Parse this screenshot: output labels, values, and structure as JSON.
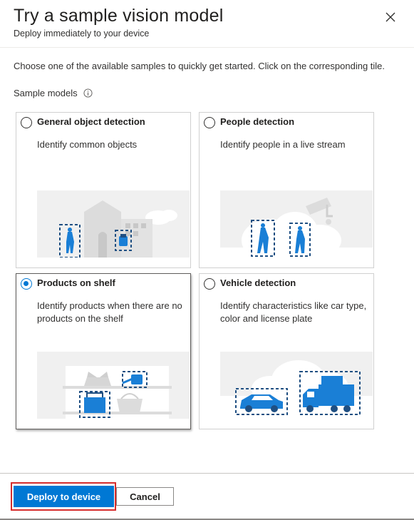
{
  "header": {
    "title": "Try a sample vision model",
    "subtitle": "Deploy immediately to your device",
    "close_icon": "close-icon"
  },
  "intro": "Choose one of the available samples to quickly get started. Click on the corresponding tile.",
  "section": {
    "label": "Sample models",
    "info_icon": "info-icon"
  },
  "tiles": [
    {
      "title": "General object detection",
      "description": "Identify common objects",
      "selected": false
    },
    {
      "title": "People detection",
      "description": "Identify people in a live stream",
      "selected": false
    },
    {
      "title": "Products on shelf",
      "description": "Identify products when there are no products on the shelf",
      "selected": true
    },
    {
      "title": "Vehicle detection",
      "description": "Identify characteristics like car type, color and license plate",
      "selected": false
    }
  ],
  "footer": {
    "primary_label": "Deploy to device",
    "secondary_label": "Cancel"
  },
  "colors": {
    "accent": "#0078d4",
    "highlight": "#d62d2d",
    "illustration_blue": "#1a7fd6",
    "illustration_dark": "#1f4f82"
  }
}
